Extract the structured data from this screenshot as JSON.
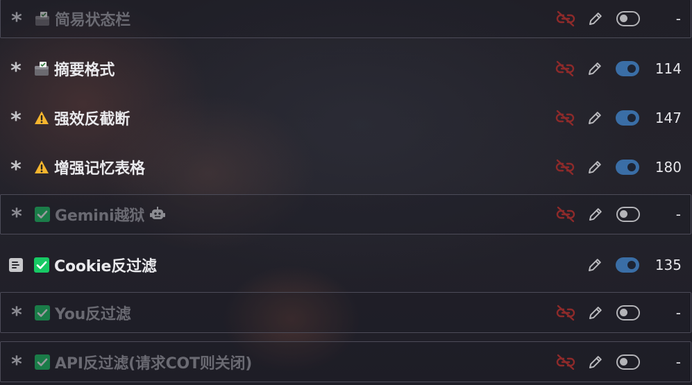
{
  "prompts": [
    {
      "handle": "asterisk",
      "emoji": "clipboard",
      "title": "简易状态栏",
      "enabled": false,
      "has_unlink": true,
      "has_robot": false,
      "count": "-"
    },
    {
      "handle": "asterisk",
      "emoji": "clipboard",
      "title": "摘要格式",
      "enabled": true,
      "has_unlink": true,
      "has_robot": false,
      "count": "114"
    },
    {
      "handle": "asterisk",
      "emoji": "warning",
      "title": "强效反截断",
      "enabled": true,
      "has_unlink": true,
      "has_robot": false,
      "count": "147"
    },
    {
      "handle": "asterisk",
      "emoji": "warning",
      "title": "增强记忆表格",
      "enabled": true,
      "has_unlink": true,
      "has_robot": false,
      "count": "180"
    },
    {
      "handle": "asterisk",
      "emoji": "check",
      "title": "Gemini越狱",
      "enabled": false,
      "has_unlink": true,
      "has_robot": true,
      "count": "-"
    },
    {
      "handle": "document",
      "emoji": "check",
      "title": "Cookie反过滤",
      "enabled": true,
      "has_unlink": false,
      "has_robot": false,
      "count": "135"
    },
    {
      "handle": "asterisk",
      "emoji": "check",
      "title": "You反过滤",
      "enabled": false,
      "has_unlink": true,
      "has_robot": false,
      "count": "-"
    },
    {
      "handle": "asterisk",
      "emoji": "check",
      "title": "API反过滤(请求COT则关闭)",
      "enabled": false,
      "has_unlink": true,
      "has_robot": false,
      "count": "-"
    }
  ],
  "colors": {
    "toggle_on": "#3a6ea6",
    "unlink": "#8e2a2a",
    "warning": "#f5b52e",
    "check": "#17c964",
    "title": "#e9e9ec",
    "title_disabled": "#6a6a72"
  }
}
